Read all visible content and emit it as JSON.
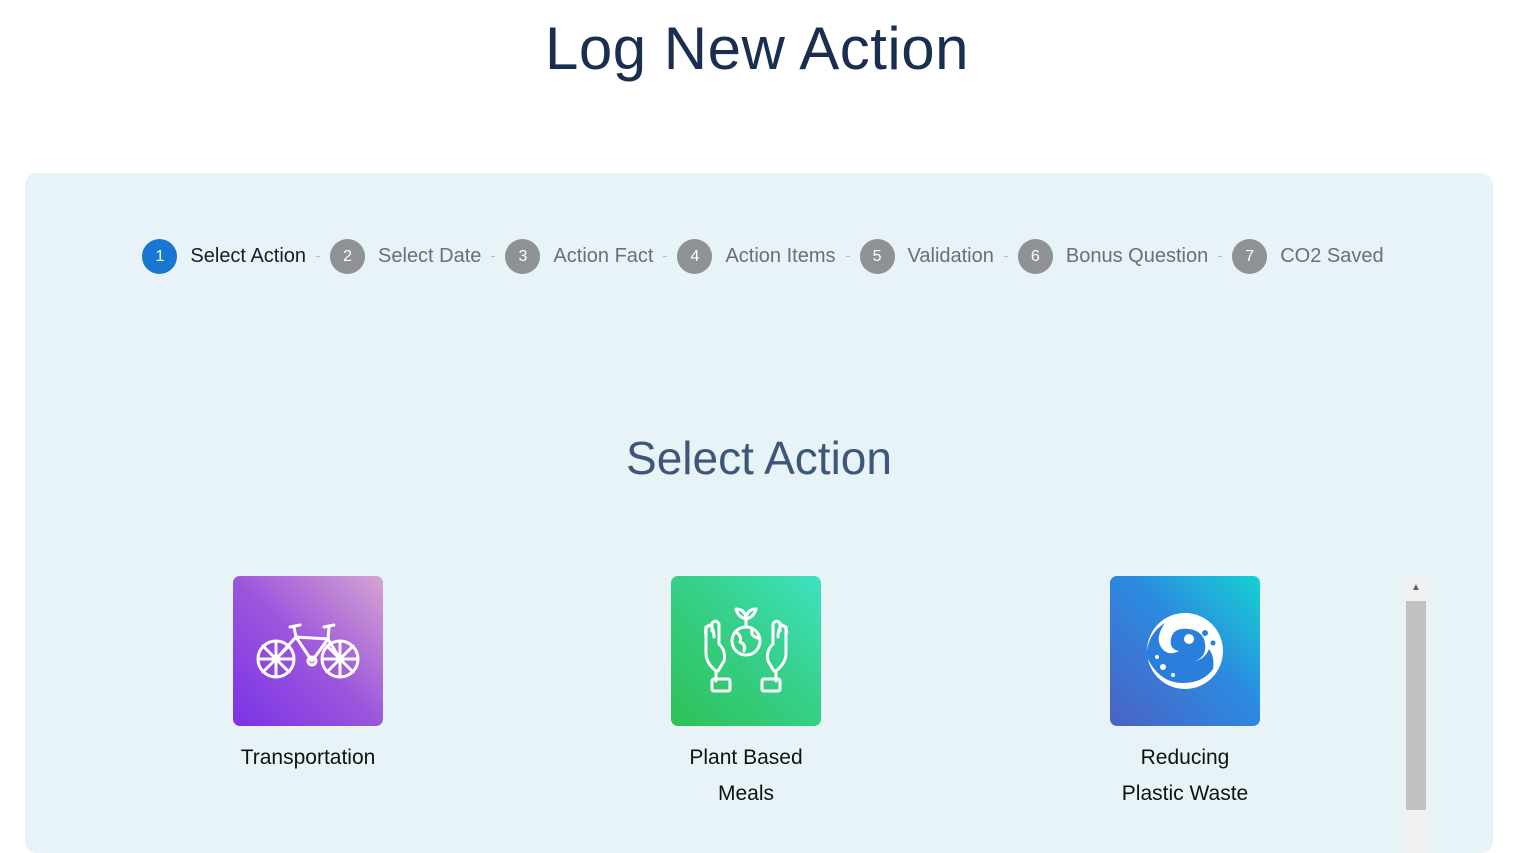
{
  "page": {
    "title": "Log New Action"
  },
  "stepper": {
    "steps": [
      {
        "number": "1",
        "label": "Select Action",
        "active": true
      },
      {
        "number": "2",
        "label": "Select Date",
        "active": false
      },
      {
        "number": "3",
        "label": "Action Fact",
        "active": false
      },
      {
        "number": "4",
        "label": "Action Items",
        "active": false
      },
      {
        "number": "5",
        "label": "Validation",
        "active": false
      },
      {
        "number": "6",
        "label": "Bonus Question",
        "active": false
      },
      {
        "number": "7",
        "label": "CO2 Saved",
        "active": false
      }
    ]
  },
  "section": {
    "title": "Select Action"
  },
  "actions": [
    {
      "label": "Transportation",
      "icon": "bicycle-icon"
    },
    {
      "label": "Plant Based\nMeals",
      "icon": "hands-globe-plant-icon"
    },
    {
      "label": "Reducing\nPlastic Waste",
      "icon": "wave-icon"
    }
  ],
  "colors": {
    "active_step": "#1976d2",
    "inactive_step": "#8e9295",
    "panel_bg": "#e8f3f8",
    "title": "#1a2f4f"
  }
}
